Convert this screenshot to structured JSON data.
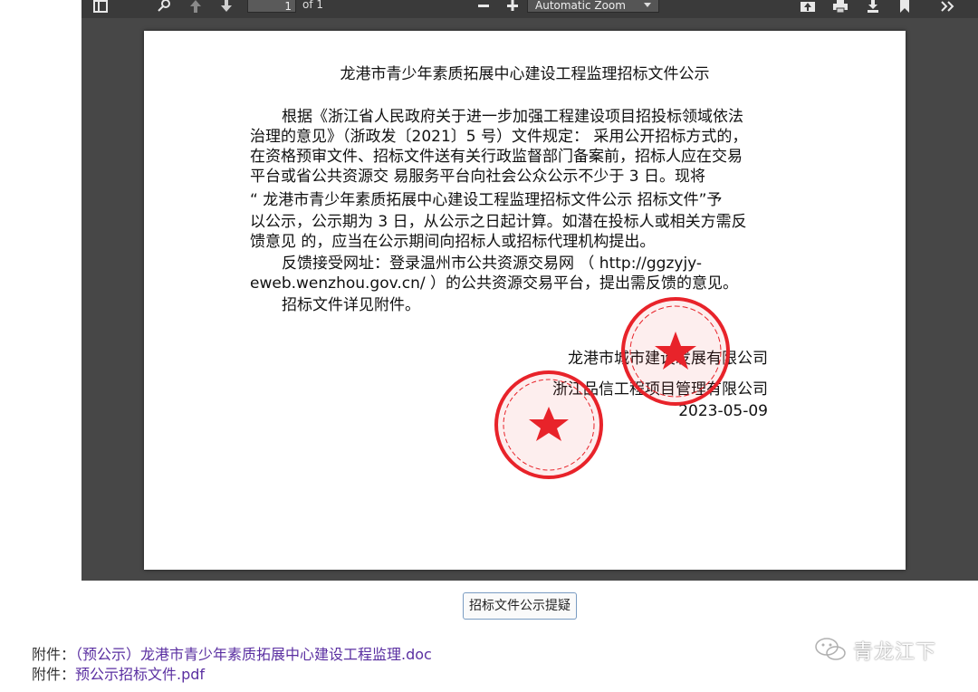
{
  "toolbar": {
    "page_current": "1",
    "page_total": "of 1",
    "zoom_value": "Automatic Zoom",
    "icons": [
      "sidebar-toggle-icon",
      "search-icon",
      "previous-page-icon",
      "next-page-icon",
      "zoom-out-icon",
      "zoom-in-icon",
      "presentation-mode-icon",
      "print-icon",
      "download-icon",
      "bookmark-icon",
      "tools-menu-icon"
    ]
  },
  "document": {
    "title": "龙港市青少年素质拓展中心建设工程监理招标文件公示",
    "body_lines": [
      "根据《浙江省人民政府关于进一步加强工程建设项目招投标领域依法",
      "治理的意见》（浙政发〔2021〕5 号）文件规定：  采用公开招标方式的，",
      "在资格预审文件、招标文件送有关行政监督部门备案前，招标人应在交易",
      "平台或省公共资源交 易服务平台向社会公众公示不少于 3 日。现将",
      "“ 龙港市青少年素质拓展中心建设工程监理招标文件公示 招标文件”予",
      "以公示，公示期为 3 日，从公示之日起计算。如潜在投标人或相关方需反",
      "馈意见 的，应当在公示期间向招标人或招标代理机构提出。",
      "反馈接受网址：登录温州市公共资源交易网 （ http://ggzyjy-",
      "eweb.wenzhou.gov.cn/ ）的公共资源交易平台，提出需反馈的意见。",
      "招标文件详见附件。"
    ],
    "signatory_1": "龙港市城市建设发展有限公司",
    "signatory_2": "浙江品信工程项目管理有限公司",
    "date": "2023-05-09",
    "stamp_color": "#e8232a"
  },
  "feedback_button_label": "招标文件公示提疑",
  "attachments": [
    {
      "label": "附件：",
      "name": "（预公示）龙港市青少年素质拓展中心建设工程监理.doc"
    },
    {
      "label": "附件：",
      "name": "预公示招标文件.pdf"
    }
  ],
  "watermark": {
    "text": "青龙江下",
    "icon": "wechat-icon"
  },
  "colors": {
    "viewer_bg": "#474747",
    "toolbar_bg": "#3a3a3a",
    "link": "#5a2fa1"
  }
}
